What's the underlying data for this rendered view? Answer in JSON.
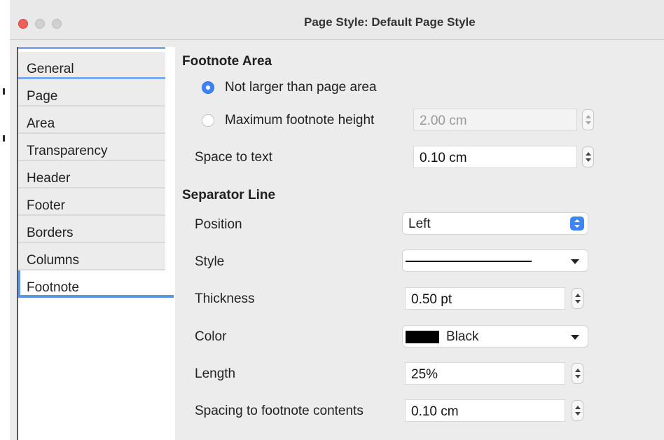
{
  "window": {
    "title": "Page Style: Default Page Style"
  },
  "sidebar": {
    "tabs": [
      {
        "label": "General"
      },
      {
        "label": "Page"
      },
      {
        "label": "Area"
      },
      {
        "label": "Transparency"
      },
      {
        "label": "Header"
      },
      {
        "label": "Footer"
      },
      {
        "label": "Borders"
      },
      {
        "label": "Columns"
      },
      {
        "label": "Footnote"
      }
    ],
    "active_tab": "Footnote"
  },
  "footnote_area": {
    "title": "Footnote Area",
    "option_not_larger": "Not larger than page area",
    "option_max_height": "Maximum footnote height",
    "selected_option": "Not larger than page area",
    "max_height_value": "2.00 cm",
    "space_to_text_label": "Space to text",
    "space_to_text_value": "0.10 cm"
  },
  "separator_line": {
    "title": "Separator Line",
    "position_label": "Position",
    "position_value": "Left",
    "style_label": "Style",
    "style_value": "solid-line",
    "thickness_label": "Thickness",
    "thickness_value": "0.50 pt",
    "color_label": "Color",
    "color_value": "Black",
    "color_hex": "#000000",
    "length_label": "Length",
    "length_value": "25%",
    "spacing_label": "Spacing to footnote contents",
    "spacing_value": "0.10 cm"
  },
  "colors": {
    "accent": "#3f84f5",
    "close_button": "#ee5f57",
    "window_background": "#ececec"
  }
}
